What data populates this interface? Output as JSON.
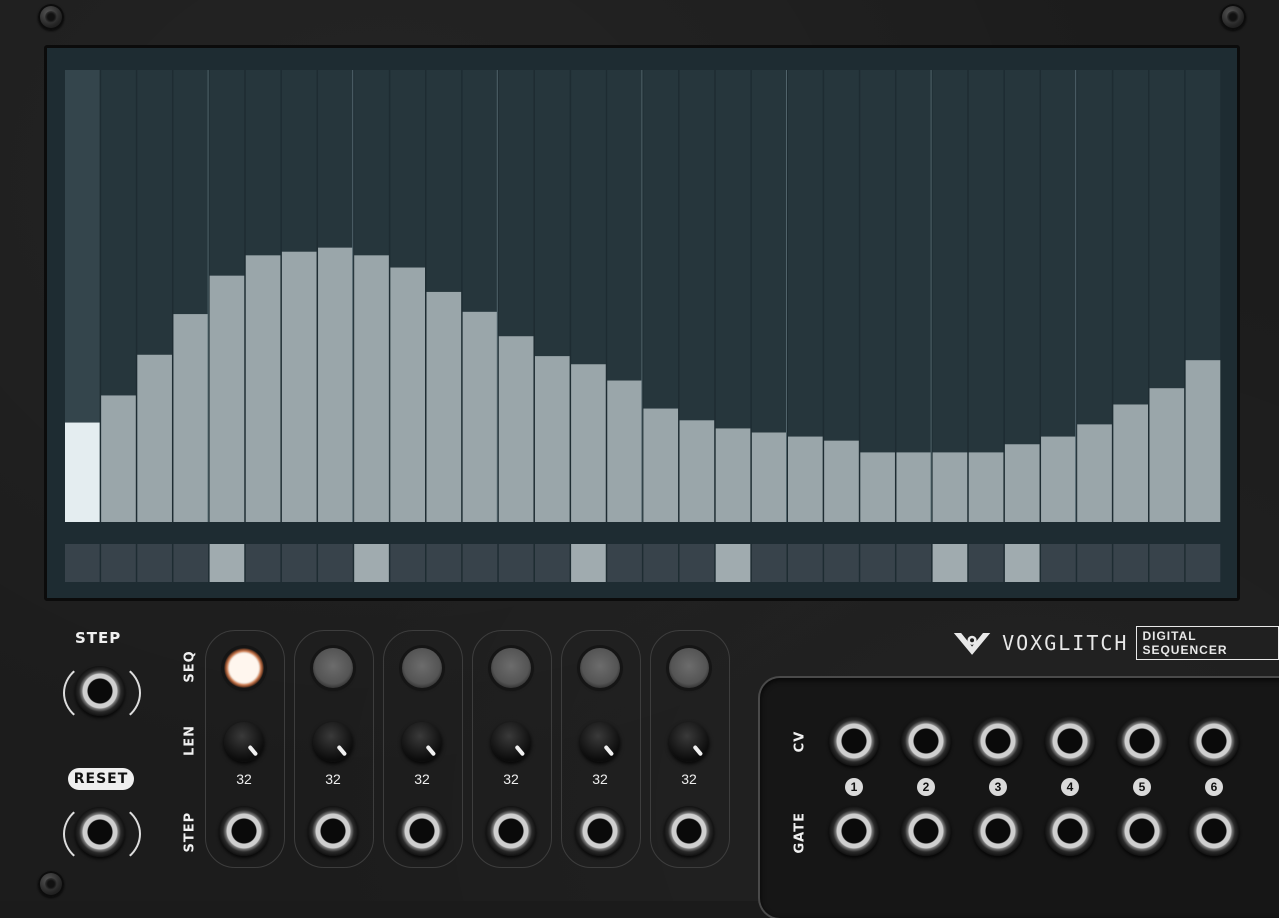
{
  "brand": {
    "name": "VOXGLITCH",
    "product": "DIGITAL SEQUENCER",
    "logo_icon": "voxglitch-v-logo-icon"
  },
  "colors": {
    "display_bg": "#1e2c32",
    "bar_active": "#e4edf0",
    "bar_fill": "#9aa6aa",
    "gate_on": "#a0abaf",
    "gate_off": "#38434b",
    "led_active": "#f2e6dc"
  },
  "sequencer": {
    "steps": 32,
    "playhead_step": 1,
    "cv_values": [
      0.22,
      0.28,
      0.37,
      0.46,
      0.545,
      0.59,
      0.598,
      0.607,
      0.59,
      0.563,
      0.509,
      0.465,
      0.411,
      0.367,
      0.349,
      0.313,
      0.251,
      0.225,
      0.207,
      0.198,
      0.189,
      0.18,
      0.154,
      0.154,
      0.154,
      0.154,
      0.172,
      0.189,
      0.216,
      0.26,
      0.296,
      0.358
    ],
    "gates": [
      0,
      0,
      0,
      0,
      1,
      0,
      0,
      0,
      1,
      0,
      0,
      0,
      0,
      0,
      1,
      0,
      0,
      0,
      1,
      0,
      0,
      0,
      0,
      0,
      1,
      0,
      1,
      0,
      0,
      0,
      0,
      0
    ]
  },
  "left": {
    "step_label": "STEP",
    "reset_label": "RESET"
  },
  "rows": {
    "seq_label": "SEQ",
    "len_label": "LEN",
    "step_label": "STEP"
  },
  "channels": [
    {
      "len": "32",
      "active": true
    },
    {
      "len": "32",
      "active": false
    },
    {
      "len": "32",
      "active": false
    },
    {
      "len": "32",
      "active": false
    },
    {
      "len": "32",
      "active": false
    },
    {
      "len": "32",
      "active": false
    }
  ],
  "outputs": {
    "cv_label": "CV",
    "gate_label": "GATE",
    "numbers": [
      "1",
      "2",
      "3",
      "4",
      "5",
      "6"
    ]
  }
}
